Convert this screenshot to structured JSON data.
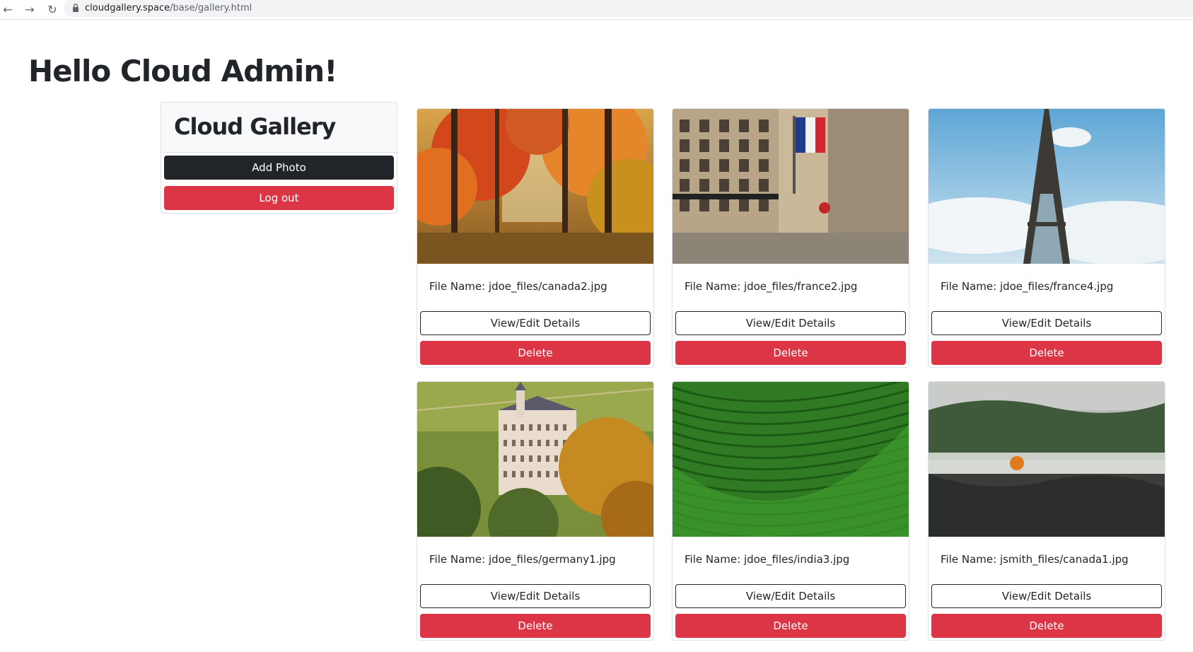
{
  "browser": {
    "url_host": "cloudgallery.space",
    "url_path": "/base/gallery.html",
    "back_icon": "back-arrow-icon",
    "forward_icon": "forward-arrow-icon",
    "reload_icon": "reload-icon",
    "lock_icon": "lock-icon"
  },
  "page": {
    "greeting": "Hello Cloud Admin!"
  },
  "sidebar": {
    "title": "Cloud Gallery",
    "add_photo_label": "Add Photo",
    "logout_label": "Log out"
  },
  "gallery": {
    "cards": [
      {
        "file_label": "File Name: jdoe_files/canada2.jpg",
        "view_label": "View/Edit Details",
        "delete_label": "Delete",
        "image": "autumn-forest"
      },
      {
        "file_label": "File Name: jdoe_files/france2.jpg",
        "view_label": "View/Edit Details",
        "delete_label": "Delete",
        "image": "paris-street"
      },
      {
        "file_label": "File Name: jdoe_files/france4.jpg",
        "view_label": "View/Edit Details",
        "delete_label": "Delete",
        "image": "eiffel-tower"
      },
      {
        "file_label": "File Name: jdoe_files/germany1.jpg",
        "view_label": "View/Edit Details",
        "delete_label": "Delete",
        "image": "castle-hillside"
      },
      {
        "file_label": "File Name: jdoe_files/india3.jpg",
        "view_label": "View/Edit Details",
        "delete_label": "Delete",
        "image": "tea-plantation"
      },
      {
        "file_label": "File Name: jsmith_files/canada1.jpg",
        "view_label": "View/Edit Details",
        "delete_label": "Delete",
        "image": "misty-lake"
      }
    ]
  },
  "colors": {
    "dark_button": "#212529",
    "danger_button": "#dc3545",
    "border": "#dee2e6"
  }
}
